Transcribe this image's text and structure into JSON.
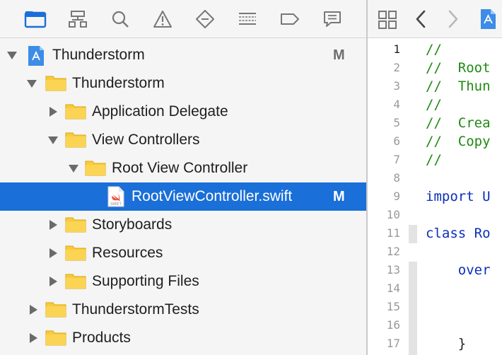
{
  "toolbar": {
    "icons": [
      "folder-icon",
      "hierarchy-icon",
      "search-icon",
      "warning-icon",
      "test-diamond-icon",
      "list-icon",
      "tag-icon",
      "comment-icon"
    ]
  },
  "navigator": {
    "rows": [
      {
        "label": "Thunderstorm",
        "kind": "project",
        "expanded": true,
        "badge": "M"
      },
      {
        "label": "Thunderstorm",
        "kind": "folder",
        "expanded": true,
        "badge": ""
      },
      {
        "label": "Application Delegate",
        "kind": "folder",
        "expanded": false,
        "badge": ""
      },
      {
        "label": "View Controllers",
        "kind": "folder",
        "expanded": true,
        "badge": ""
      },
      {
        "label": "Root View Controller",
        "kind": "folder",
        "expanded": true,
        "badge": ""
      },
      {
        "label": "RootViewController.swift",
        "kind": "swift",
        "selected": true,
        "badge": "M"
      },
      {
        "label": "Storyboards",
        "kind": "folder",
        "expanded": false,
        "badge": ""
      },
      {
        "label": "Resources",
        "kind": "folder",
        "expanded": false,
        "badge": ""
      },
      {
        "label": "Supporting Files",
        "kind": "folder",
        "expanded": false,
        "badge": ""
      },
      {
        "label": "ThunderstormTests",
        "kind": "folder",
        "expanded": false,
        "badge": ""
      },
      {
        "label": "Products",
        "kind": "folder",
        "expanded": false,
        "badge": ""
      }
    ]
  },
  "editor": {
    "jump_bar": {
      "icons": [
        "grid-icon",
        "back-chevron-icon",
        "forward-chevron-icon",
        "file-icon"
      ]
    },
    "line_numbers": [
      "1",
      "2",
      "3",
      "4",
      "5",
      "6",
      "7",
      "8",
      "9",
      "10",
      "11",
      "12",
      "13",
      "14",
      "15",
      "16",
      "17"
    ],
    "code_lines": [
      {
        "text": "//",
        "style": "comment"
      },
      {
        "text": "//  Root",
        "style": "comment"
      },
      {
        "text": "//  Thun",
        "style": "comment"
      },
      {
        "text": "//",
        "style": "comment"
      },
      {
        "text": "//  Crea",
        "style": "comment"
      },
      {
        "text": "//  Copy",
        "style": "comment"
      },
      {
        "text": "//",
        "style": "comment"
      },
      {
        "text": "",
        "style": "plain"
      },
      {
        "text": "import U",
        "style": "keyword"
      },
      {
        "text": "",
        "style": "plain"
      },
      {
        "text": "class Ro",
        "style": "keyword"
      },
      {
        "text": "",
        "style": "plain"
      },
      {
        "text": "    over",
        "style": "keyword"
      },
      {
        "text": "",
        "style": "plain"
      },
      {
        "text": "",
        "style": "plain"
      },
      {
        "text": "",
        "style": "plain"
      },
      {
        "text": "    }",
        "style": "plain"
      }
    ]
  },
  "colors": {
    "selection": "#1a6fd8",
    "folder": "#f9cb3a",
    "comment": "#1f8a12",
    "keyword": "#0b2fb8",
    "toolbar_active": "#1a6fd8"
  }
}
